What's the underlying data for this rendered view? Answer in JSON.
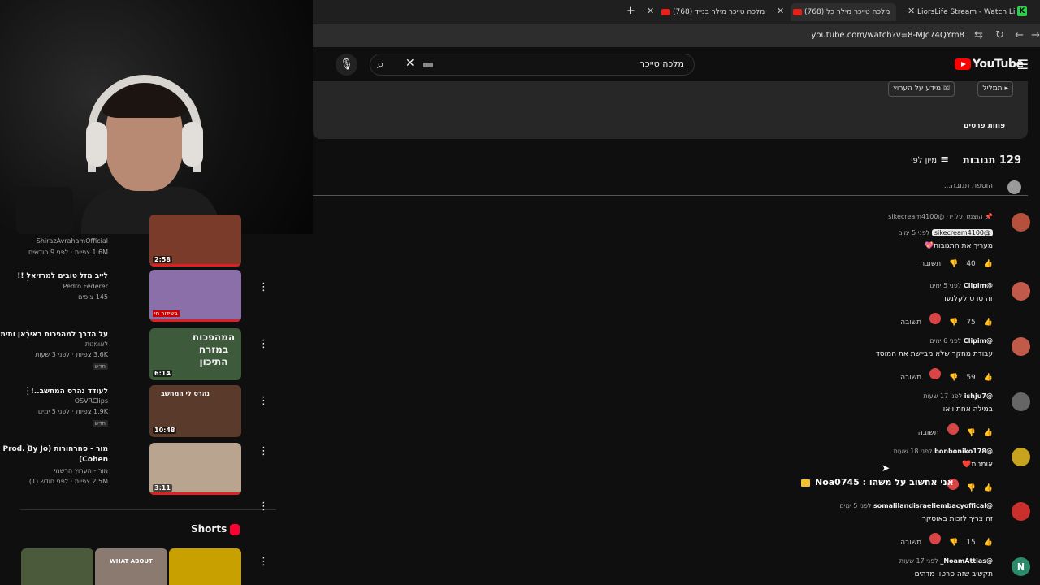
{
  "browser": {
    "tabs": [
      {
        "title": "LiorsLife Stream - Watch Live on"
      },
      {
        "title": "(768) מלכה טייכר מילר כל"
      },
      {
        "title": "(768) מלכה טייכר מילר בנייד"
      }
    ],
    "url": "youtube.com/watch?v=8-MJc74QYm8"
  },
  "youtube": {
    "logo_text": "YouTube",
    "search_query": "מלכה טייכר"
  },
  "description": {
    "chip_transcript": "תמליל",
    "chip_info": "מידע על הערוץ",
    "show_less": "פחות פרטים"
  },
  "comments_header": {
    "count": "129 תגובות",
    "sort_label": "מיון לפי",
    "add_placeholder": "הוספת תגובה..."
  },
  "comments": [
    {
      "pinned_by": "הוצמד על ידי @sikecream4100",
      "author": "@sikecream4100",
      "time": "לפני 5 ימים",
      "text": "מעריך את התגובות💖",
      "likes": "40",
      "reply": "תשובה",
      "avatar_color": "#b5503d"
    },
    {
      "pinned_by": "",
      "author": "@Clipim",
      "time": "לפני 5 ימים",
      "text": "זה סרט לקלנעו",
      "likes": "75",
      "reply": "תשובה",
      "avatar_color": "#c25a4a"
    },
    {
      "pinned_by": "",
      "author": "@Clipim",
      "time": "לפני 6 ימים",
      "text": "עבודת מחקר שלא מביישת את המוסד",
      "likes": "59",
      "reply": "תשובה",
      "avatar_color": "#c25a4a"
    },
    {
      "pinned_by": "",
      "author": "@ishju7",
      "time": "לפני 17 שעות",
      "text": "במילה אחת וואו",
      "likes": "",
      "reply": "תשובה",
      "avatar_color": "#666666"
    },
    {
      "pinned_by": "",
      "author": "@bonboniko178",
      "time": "לפני 18 שעות",
      "text": "אומנות❤️",
      "likes": "",
      "reply": "",
      "avatar_color": "#c7a31e"
    },
    {
      "pinned_by": "",
      "author": "@somalilandisraeliembacyoffical",
      "time": "לפני 5 ימים",
      "text": "זה צריך לזכות באוסקר",
      "likes": "15",
      "reply": "תשובה",
      "avatar_color": "#c9302c"
    },
    {
      "pinned_by": "",
      "author": "@NoamAttias_",
      "time": "לפני 17 שעות",
      "text": "תקשיב שזה סרטון מדהים",
      "likes": "",
      "reply": "",
      "avatar_color": "#2a8a6a",
      "avatar_letter": "N"
    }
  ],
  "overlay": {
    "message": "Noa0745 : אני אחשוב על משהו"
  },
  "recommendations": [
    {
      "title": "",
      "channel": "ShirazAvrahamOfficial",
      "stats": "1.6M צפיות · לפני 9 חודשים",
      "duration": "2:58",
      "thumb_color": "#7a3b2b",
      "badge": ""
    },
    {
      "title": "לייב מזל טובים למרזיאל !!",
      "channel": "Pedro Federer",
      "stats": "145 צופים",
      "duration": "",
      "live_label": "בשידור חי",
      "thumb_color": "#8b6fa8",
      "badge": ""
    },
    {
      "title": "על הדרך למהפכות באיראן ותימן",
      "channel": "לאומנות",
      "stats": "3.6K צפיות · לפני 3 שעות",
      "duration": "6:14",
      "thumb_color": "#3d5a3a",
      "thumb_text": "המהפכות במזרח התיכון",
      "badge": "חדש"
    },
    {
      "title": "לעודד נהרס המחשב..!",
      "channel": "OSVRClips",
      "stats": "1.9K צפיות · לפני 5 ימים",
      "duration": "10:48",
      "thumb_color": "#5a3a2a",
      "thumb_text": "נהרס לי המחשב",
      "badge": "חדש"
    },
    {
      "title": "מור - סחרחורות (Prod. By Jo Cohen)",
      "channel": "מור - הערוץ הרשמי",
      "stats": "2.5M צפיות · לפני חודש (1)",
      "duration": "3:11",
      "thumb_color": "#b8a48f",
      "badge": ""
    }
  ],
  "shorts": {
    "title": "Shorts",
    "items": [
      {
        "label": "",
        "color": "#4a5a3a"
      },
      {
        "label": "WHAT ABOUT",
        "color": "#8a7a70"
      },
      {
        "label": "",
        "color": "#c8a000"
      }
    ]
  }
}
